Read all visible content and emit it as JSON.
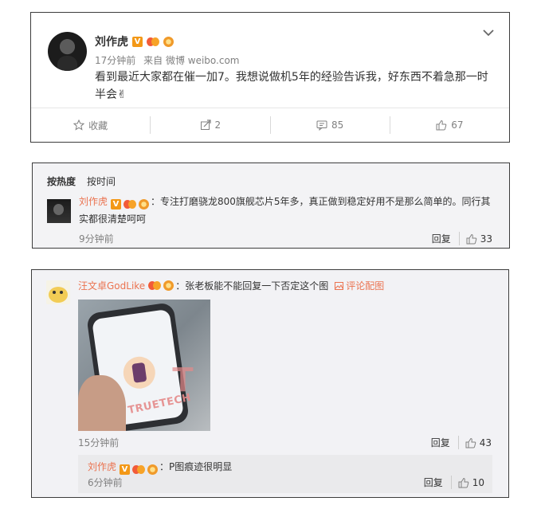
{
  "post": {
    "author": "刘作虎",
    "time": "17分钟前",
    "source_prefix": "来自",
    "source": "微博 weibo.com",
    "text": "看到最近大家都在催一加7。我想说做机5年的经验告诉我，好东西不着急那一时半会",
    "emoji": "✌",
    "actions": {
      "favorite_label": "收藏",
      "repost_count": "2",
      "comment_count": "85",
      "like_count": "67"
    }
  },
  "comments": {
    "sort_hot": "按热度",
    "sort_time": "按时间",
    "top_comment": {
      "author": "刘作虎",
      "text": "：专注打磨骁龙800旗舰芯片5年多，真正做到稳定好用不是那么简单的。同行其实都很清楚呵呵",
      "time": "9分钟前",
      "reply_label": "回复",
      "likes": "33"
    }
  },
  "thread": {
    "comment": {
      "author": "汪文卓GodLike",
      "text": "：张老板能不能回复一下否定这个图",
      "pic_link": "评论配图",
      "watermark": "TRUETECH",
      "time": "15分钟前",
      "reply_label": "回复",
      "likes": "43"
    },
    "reply": {
      "author": "刘作虎",
      "text": "：P图痕迹很明显",
      "time": "6分钟前",
      "reply_label": "回复",
      "likes": "10"
    }
  },
  "icons": {
    "verified": "V",
    "chevron": "chevron-down-icon"
  },
  "colors": {
    "name_link": "#eb7350",
    "verified_badge": "#f39817",
    "muted_text": "#808080"
  }
}
